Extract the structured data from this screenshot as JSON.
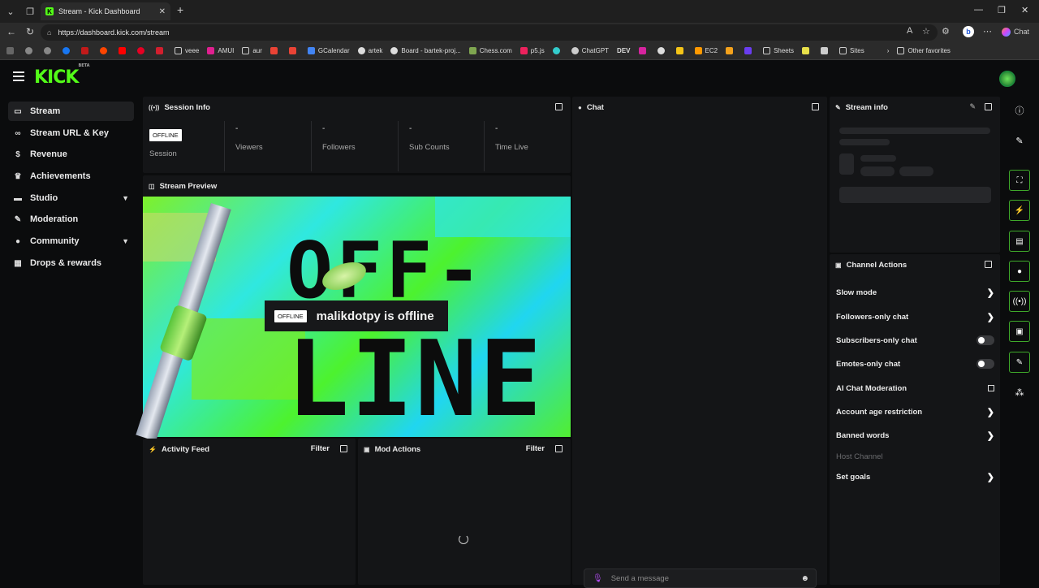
{
  "browser": {
    "tab_title": "Stream - Kick Dashboard",
    "url": "https://dashboard.kick.com/stream",
    "bookmarks": [
      "veee",
      "AMUI",
      "aur",
      "GCalendar",
      "artek",
      "Board - bartek-proj...",
      "Chess.com",
      "p5.js",
      "ChatGPT",
      "DEV",
      "EC2",
      "Sheets",
      "Sites",
      "Other favorites"
    ],
    "chat_button": "Chat"
  },
  "app": {
    "logo": "KICK",
    "logo_badge": "BETA"
  },
  "sidebar": {
    "items": [
      {
        "label": "Stream"
      },
      {
        "label": "Stream URL & Key"
      },
      {
        "label": "Revenue"
      },
      {
        "label": "Achievements"
      },
      {
        "label": "Studio"
      },
      {
        "label": "Moderation"
      },
      {
        "label": "Community"
      },
      {
        "label": "Drops & rewards"
      }
    ]
  },
  "session": {
    "title": "Session Info",
    "badge": "OFFLINE",
    "session_label": "Session",
    "stats": [
      {
        "value": "-",
        "label": "Viewers"
      },
      {
        "value": "-",
        "label": "Followers"
      },
      {
        "value": "-",
        "label": "Sub Counts"
      },
      {
        "value": "-",
        "label": "Time Live"
      }
    ]
  },
  "preview": {
    "title": "Stream Preview",
    "art_top": "OFF-",
    "art_bottom": "LINE",
    "badge": "OFFLINE",
    "message": "malikdotpy is offline"
  },
  "activity": {
    "title": "Activity Feed",
    "filter": "Filter"
  },
  "mod": {
    "title": "Mod Actions",
    "filter": "Filter"
  },
  "chat": {
    "title": "Chat",
    "placeholder": "Send a message"
  },
  "stream_info": {
    "title": "Stream info"
  },
  "channel_actions": {
    "title": "Channel Actions",
    "items": [
      {
        "label": "Slow mode"
      },
      {
        "label": "Followers-only chat"
      },
      {
        "label": "Subscribers-only chat"
      },
      {
        "label": "Emotes-only chat"
      },
      {
        "label": "AI Chat Moderation"
      },
      {
        "label": "Account age restriction"
      },
      {
        "label": "Banned words"
      },
      {
        "label": "Host Channel"
      },
      {
        "label": "Set goals"
      }
    ]
  },
  "colors": {
    "accent": "#53fc18",
    "panel": "#141517",
    "background": "#0b0c0d"
  }
}
